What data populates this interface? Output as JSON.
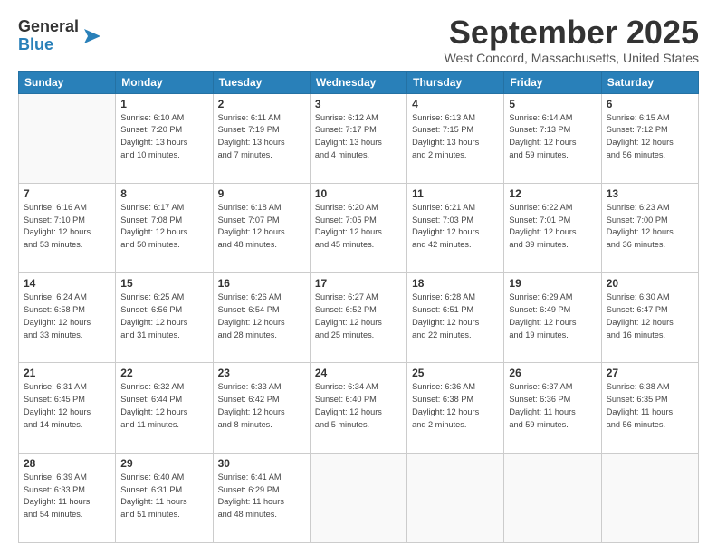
{
  "header": {
    "logo_general": "General",
    "logo_blue": "Blue",
    "month_title": "September 2025",
    "location": "West Concord, Massachusetts, United States"
  },
  "weekdays": [
    "Sunday",
    "Monday",
    "Tuesday",
    "Wednesday",
    "Thursday",
    "Friday",
    "Saturday"
  ],
  "weeks": [
    [
      {
        "day": "",
        "info": ""
      },
      {
        "day": "1",
        "info": "Sunrise: 6:10 AM\nSunset: 7:20 PM\nDaylight: 13 hours\nand 10 minutes."
      },
      {
        "day": "2",
        "info": "Sunrise: 6:11 AM\nSunset: 7:19 PM\nDaylight: 13 hours\nand 7 minutes."
      },
      {
        "day": "3",
        "info": "Sunrise: 6:12 AM\nSunset: 7:17 PM\nDaylight: 13 hours\nand 4 minutes."
      },
      {
        "day": "4",
        "info": "Sunrise: 6:13 AM\nSunset: 7:15 PM\nDaylight: 13 hours\nand 2 minutes."
      },
      {
        "day": "5",
        "info": "Sunrise: 6:14 AM\nSunset: 7:13 PM\nDaylight: 12 hours\nand 59 minutes."
      },
      {
        "day": "6",
        "info": "Sunrise: 6:15 AM\nSunset: 7:12 PM\nDaylight: 12 hours\nand 56 minutes."
      }
    ],
    [
      {
        "day": "7",
        "info": "Sunrise: 6:16 AM\nSunset: 7:10 PM\nDaylight: 12 hours\nand 53 minutes."
      },
      {
        "day": "8",
        "info": "Sunrise: 6:17 AM\nSunset: 7:08 PM\nDaylight: 12 hours\nand 50 minutes."
      },
      {
        "day": "9",
        "info": "Sunrise: 6:18 AM\nSunset: 7:07 PM\nDaylight: 12 hours\nand 48 minutes."
      },
      {
        "day": "10",
        "info": "Sunrise: 6:20 AM\nSunset: 7:05 PM\nDaylight: 12 hours\nand 45 minutes."
      },
      {
        "day": "11",
        "info": "Sunrise: 6:21 AM\nSunset: 7:03 PM\nDaylight: 12 hours\nand 42 minutes."
      },
      {
        "day": "12",
        "info": "Sunrise: 6:22 AM\nSunset: 7:01 PM\nDaylight: 12 hours\nand 39 minutes."
      },
      {
        "day": "13",
        "info": "Sunrise: 6:23 AM\nSunset: 7:00 PM\nDaylight: 12 hours\nand 36 minutes."
      }
    ],
    [
      {
        "day": "14",
        "info": "Sunrise: 6:24 AM\nSunset: 6:58 PM\nDaylight: 12 hours\nand 33 minutes."
      },
      {
        "day": "15",
        "info": "Sunrise: 6:25 AM\nSunset: 6:56 PM\nDaylight: 12 hours\nand 31 minutes."
      },
      {
        "day": "16",
        "info": "Sunrise: 6:26 AM\nSunset: 6:54 PM\nDaylight: 12 hours\nand 28 minutes."
      },
      {
        "day": "17",
        "info": "Sunrise: 6:27 AM\nSunset: 6:52 PM\nDaylight: 12 hours\nand 25 minutes."
      },
      {
        "day": "18",
        "info": "Sunrise: 6:28 AM\nSunset: 6:51 PM\nDaylight: 12 hours\nand 22 minutes."
      },
      {
        "day": "19",
        "info": "Sunrise: 6:29 AM\nSunset: 6:49 PM\nDaylight: 12 hours\nand 19 minutes."
      },
      {
        "day": "20",
        "info": "Sunrise: 6:30 AM\nSunset: 6:47 PM\nDaylight: 12 hours\nand 16 minutes."
      }
    ],
    [
      {
        "day": "21",
        "info": "Sunrise: 6:31 AM\nSunset: 6:45 PM\nDaylight: 12 hours\nand 14 minutes."
      },
      {
        "day": "22",
        "info": "Sunrise: 6:32 AM\nSunset: 6:44 PM\nDaylight: 12 hours\nand 11 minutes."
      },
      {
        "day": "23",
        "info": "Sunrise: 6:33 AM\nSunset: 6:42 PM\nDaylight: 12 hours\nand 8 minutes."
      },
      {
        "day": "24",
        "info": "Sunrise: 6:34 AM\nSunset: 6:40 PM\nDaylight: 12 hours\nand 5 minutes."
      },
      {
        "day": "25",
        "info": "Sunrise: 6:36 AM\nSunset: 6:38 PM\nDaylight: 12 hours\nand 2 minutes."
      },
      {
        "day": "26",
        "info": "Sunrise: 6:37 AM\nSunset: 6:36 PM\nDaylight: 11 hours\nand 59 minutes."
      },
      {
        "day": "27",
        "info": "Sunrise: 6:38 AM\nSunset: 6:35 PM\nDaylight: 11 hours\nand 56 minutes."
      }
    ],
    [
      {
        "day": "28",
        "info": "Sunrise: 6:39 AM\nSunset: 6:33 PM\nDaylight: 11 hours\nand 54 minutes."
      },
      {
        "day": "29",
        "info": "Sunrise: 6:40 AM\nSunset: 6:31 PM\nDaylight: 11 hours\nand 51 minutes."
      },
      {
        "day": "30",
        "info": "Sunrise: 6:41 AM\nSunset: 6:29 PM\nDaylight: 11 hours\nand 48 minutes."
      },
      {
        "day": "",
        "info": ""
      },
      {
        "day": "",
        "info": ""
      },
      {
        "day": "",
        "info": ""
      },
      {
        "day": "",
        "info": ""
      }
    ]
  ]
}
